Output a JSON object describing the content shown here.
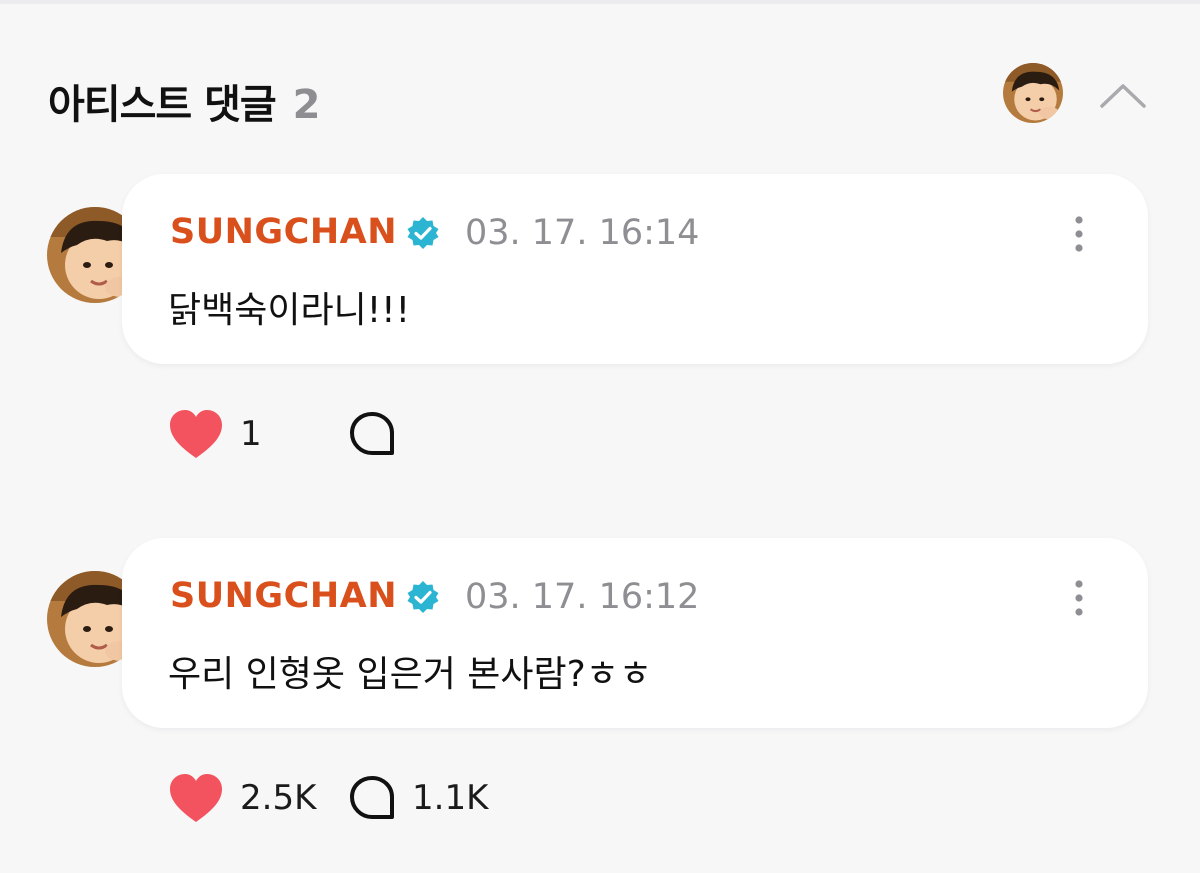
{
  "header": {
    "title": "아티스트 댓글",
    "count": "2"
  },
  "comments": [
    {
      "author": "SUNGCHAN",
      "timestamp": "03. 17. 16:14",
      "text": "닭백숙이라니!!!",
      "likes": "1",
      "replies": ""
    },
    {
      "author": "SUNGCHAN",
      "timestamp": "03. 17. 16:12",
      "text": "우리 인형옷 입은거 본사람?ㅎㅎ",
      "likes": "2.5K",
      "replies": "1.1K"
    }
  ],
  "colors": {
    "author": "#d9501c",
    "verified": "#2bb5d3",
    "heart": "#f2535f",
    "background": "#f7f7f8",
    "card": "#ffffff"
  },
  "icons": {
    "verified": "verified-badge-icon",
    "more": "more-vertical-icon",
    "like": "heart-icon",
    "reply": "speech-bubble-icon",
    "collapse": "chevron-up-icon"
  }
}
